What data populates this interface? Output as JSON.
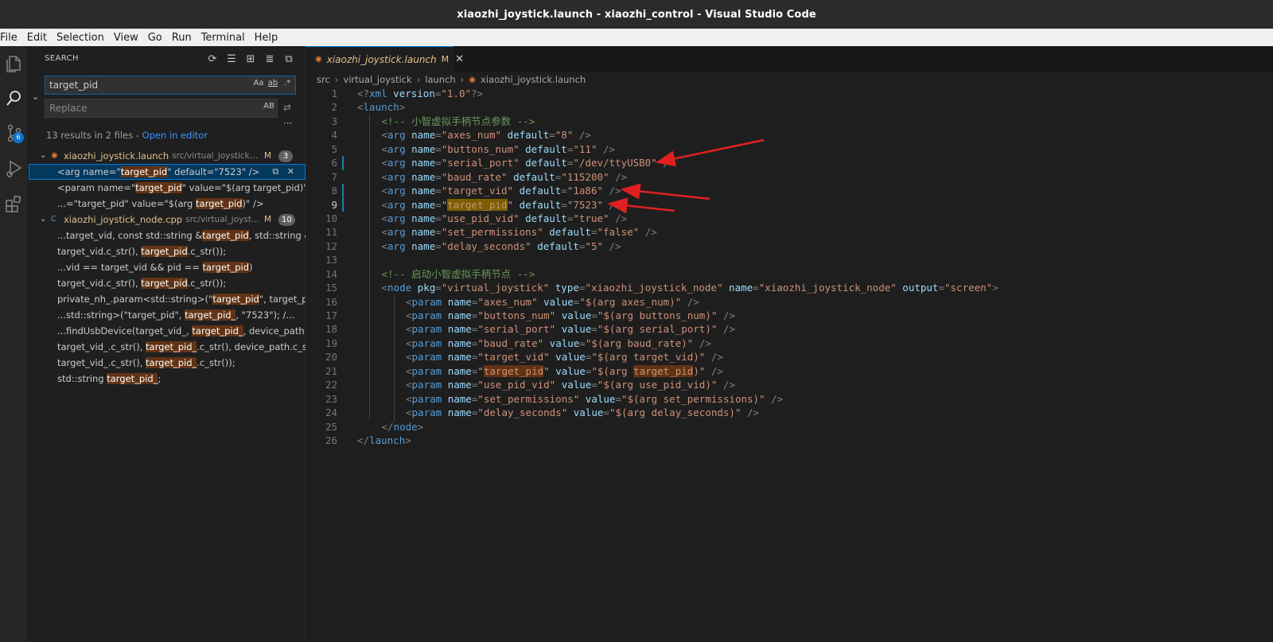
{
  "window": {
    "title": "xiaozhi_joystick.launch - xiaozhi_control - Visual Studio Code"
  },
  "menu": [
    "File",
    "Edit",
    "Selection",
    "View",
    "Go",
    "Run",
    "Terminal",
    "Help"
  ],
  "activity": {
    "scm_badge": "6"
  },
  "search": {
    "header": "SEARCH",
    "query": "target_pid",
    "replace_placeholder": "Replace",
    "opt_case": "Aa",
    "opt_word": "ab",
    "opt_regex": ".*",
    "opt_preserve_case": "AB",
    "summary_text": "13 results in 2 files - ",
    "open_in_editor": "Open in editor"
  },
  "results": [
    {
      "file": "xiaozhi_joystick.launch",
      "path": "src/virtual_joystick/l...",
      "status": "M",
      "count": "3",
      "matches": [
        {
          "pre": "<arg name=\"",
          "hit": "target_pid",
          "post": "\" default=\"7523\" />",
          "selected": true
        },
        {
          "pre": "<param name=\"",
          "hit": "target_pid",
          "post": "\" value=\"$(arg target_pid)\" />"
        },
        {
          "pre": "...=\"target_pid\" value=\"$(arg ",
          "hit": "target_pid",
          "post": ")\" />"
        }
      ]
    },
    {
      "file": "xiaozhi_joystick_node.cpp",
      "path": "src/virtual_joyst...",
      "status": "M",
      "count": "10",
      "matches": [
        {
          "pre": "...target_vid, const std::string &",
          "hit": "target_pid",
          "post": ", std::string &..."
        },
        {
          "pre": "target_vid.c_str(), ",
          "hit": "target_pid",
          "post": ".c_str());"
        },
        {
          "pre": "...vid == target_vid && pid == ",
          "hit": "target_pid",
          "post": ")"
        },
        {
          "pre": "target_vid.c_str(), ",
          "hit": "target_pid",
          "post": ".c_str());"
        },
        {
          "pre": "private_nh_.param<std::string>(\"",
          "hit": "target_pid",
          "post": "\", target_pi..."
        },
        {
          "pre": "...std::string>(\"target_pid\", ",
          "hit": "target_pid_",
          "post": ", \"7523\");        /..."
        },
        {
          "pre": "...findUsbDevice(target_vid_, ",
          "hit": "target_pid_",
          "post": ", device_path))"
        },
        {
          "pre": "target_vid_.c_str(), ",
          "hit": "target_pid_",
          "post": ".c_str(), device_path.c_s..."
        },
        {
          "pre": "target_vid_.c_str(), ",
          "hit": "target_pid_",
          "post": ".c_str());"
        },
        {
          "pre": "std::string ",
          "hit": "target_pid_",
          "post": ";"
        }
      ]
    }
  ],
  "editor": {
    "tab_label": "xiaozhi_joystick.launch",
    "tab_status": "M",
    "breadcrumb": [
      "src",
      "virtual_joystick",
      "launch",
      "xiaozhi_joystick.launch"
    ],
    "active_line": "9",
    "lines": [
      {
        "n": "1",
        "indent": 0,
        "tokens": [
          [
            "p",
            "<?"
          ],
          [
            "t",
            "xml"
          ],
          [
            "a",
            " version"
          ],
          [
            "p",
            "="
          ],
          [
            "s",
            "\"1.0\""
          ],
          [
            "p",
            "?>"
          ]
        ]
      },
      {
        "n": "2",
        "indent": 0,
        "tokens": [
          [
            "p",
            "<"
          ],
          [
            "t",
            "launch"
          ],
          [
            "p",
            ">"
          ]
        ]
      },
      {
        "n": "3",
        "indent": 1,
        "tokens": [
          [
            "c",
            "<!-- 小智虚拟手柄节点参数 -->"
          ]
        ]
      },
      {
        "n": "4",
        "indent": 1,
        "tokens": [
          [
            "p",
            "<"
          ],
          [
            "t",
            "arg"
          ],
          [
            "a",
            " name"
          ],
          [
            "p",
            "="
          ],
          [
            "s",
            "\"axes_num\""
          ],
          [
            "a",
            " default"
          ],
          [
            "p",
            "="
          ],
          [
            "s",
            "\"8\""
          ],
          [
            "p",
            " />"
          ]
        ]
      },
      {
        "n": "5",
        "indent": 1,
        "tokens": [
          [
            "p",
            "<"
          ],
          [
            "t",
            "arg"
          ],
          [
            "a",
            " name"
          ],
          [
            "p",
            "="
          ],
          [
            "s",
            "\"buttons_num\""
          ],
          [
            "a",
            " default"
          ],
          [
            "p",
            "="
          ],
          [
            "s",
            "\"11\""
          ],
          [
            "p",
            " />"
          ]
        ]
      },
      {
        "n": "6",
        "indent": 1,
        "tokens": [
          [
            "p",
            "<"
          ],
          [
            "t",
            "arg"
          ],
          [
            "a",
            " name"
          ],
          [
            "p",
            "="
          ],
          [
            "s",
            "\"serial_port\""
          ],
          [
            "a",
            " default"
          ],
          [
            "p",
            "="
          ],
          [
            "s",
            "\"/dev/ttyUSB0\""
          ],
          [
            "p",
            " />"
          ]
        ]
      },
      {
        "n": "7",
        "indent": 1,
        "tokens": [
          [
            "p",
            "<"
          ],
          [
            "t",
            "arg"
          ],
          [
            "a",
            " name"
          ],
          [
            "p",
            "="
          ],
          [
            "s",
            "\"baud_rate\""
          ],
          [
            "a",
            " default"
          ],
          [
            "p",
            "="
          ],
          [
            "s",
            "\"115200\""
          ],
          [
            "p",
            " />"
          ]
        ]
      },
      {
        "n": "8",
        "indent": 1,
        "tokens": [
          [
            "p",
            "<"
          ],
          [
            "t",
            "arg"
          ],
          [
            "a",
            " name"
          ],
          [
            "p",
            "="
          ],
          [
            "s",
            "\"target_vid\""
          ],
          [
            "a",
            " default"
          ],
          [
            "p",
            "="
          ],
          [
            "s",
            "\"1a86\""
          ],
          [
            "p",
            " />"
          ]
        ]
      },
      {
        "n": "9",
        "indent": 1,
        "tokens": [
          [
            "p",
            "<"
          ],
          [
            "t",
            "arg"
          ],
          [
            "a",
            " name"
          ],
          [
            "p",
            "="
          ],
          [
            "s",
            "\""
          ],
          [
            "m",
            "target_pid"
          ],
          [
            "s",
            "\""
          ],
          [
            "a",
            " default"
          ],
          [
            "p",
            "="
          ],
          [
            "s",
            "\"7523\""
          ],
          [
            "p",
            " />"
          ]
        ]
      },
      {
        "n": "10",
        "indent": 1,
        "tokens": [
          [
            "p",
            "<"
          ],
          [
            "t",
            "arg"
          ],
          [
            "a",
            " name"
          ],
          [
            "p",
            "="
          ],
          [
            "s",
            "\"use_pid_vid\""
          ],
          [
            "a",
            " default"
          ],
          [
            "p",
            "="
          ],
          [
            "s",
            "\"true\""
          ],
          [
            "p",
            " />"
          ]
        ]
      },
      {
        "n": "11",
        "indent": 1,
        "tokens": [
          [
            "p",
            "<"
          ],
          [
            "t",
            "arg"
          ],
          [
            "a",
            " name"
          ],
          [
            "p",
            "="
          ],
          [
            "s",
            "\"set_permissions\""
          ],
          [
            "a",
            " default"
          ],
          [
            "p",
            "="
          ],
          [
            "s",
            "\"false\""
          ],
          [
            "p",
            " />"
          ]
        ]
      },
      {
        "n": "12",
        "indent": 1,
        "tokens": [
          [
            "p",
            "<"
          ],
          [
            "t",
            "arg"
          ],
          [
            "a",
            " name"
          ],
          [
            "p",
            "="
          ],
          [
            "s",
            "\"delay_seconds\""
          ],
          [
            "a",
            " default"
          ],
          [
            "p",
            "="
          ],
          [
            "s",
            "\"5\""
          ],
          [
            "p",
            " />"
          ]
        ]
      },
      {
        "n": "13",
        "indent": 0,
        "tokens": []
      },
      {
        "n": "14",
        "indent": 1,
        "tokens": [
          [
            "c",
            "<!-- 启动小智虚拟手柄节点 -->"
          ]
        ]
      },
      {
        "n": "15",
        "indent": 1,
        "tokens": [
          [
            "p",
            "<"
          ],
          [
            "t",
            "node"
          ],
          [
            "a",
            " pkg"
          ],
          [
            "p",
            "="
          ],
          [
            "s",
            "\"virtual_joystick\""
          ],
          [
            "a",
            " type"
          ],
          [
            "p",
            "="
          ],
          [
            "s",
            "\"xiaozhi_joystick_node\""
          ],
          [
            "a",
            " name"
          ],
          [
            "p",
            "="
          ],
          [
            "s",
            "\"xiaozhi_joystick_node\""
          ],
          [
            "a",
            " output"
          ],
          [
            "p",
            "="
          ],
          [
            "s",
            "\"screen\""
          ],
          [
            "p",
            ">"
          ]
        ]
      },
      {
        "n": "16",
        "indent": 2,
        "tokens": [
          [
            "p",
            "<"
          ],
          [
            "t",
            "param"
          ],
          [
            "a",
            " name"
          ],
          [
            "p",
            "="
          ],
          [
            "s",
            "\"axes_num\""
          ],
          [
            "a",
            " value"
          ],
          [
            "p",
            "="
          ],
          [
            "s",
            "\"$(arg axes_num)\""
          ],
          [
            "p",
            " />"
          ]
        ]
      },
      {
        "n": "17",
        "indent": 2,
        "tokens": [
          [
            "p",
            "<"
          ],
          [
            "t",
            "param"
          ],
          [
            "a",
            " name"
          ],
          [
            "p",
            "="
          ],
          [
            "s",
            "\"buttons_num\""
          ],
          [
            "a",
            " value"
          ],
          [
            "p",
            "="
          ],
          [
            "s",
            "\"$(arg buttons_num)\""
          ],
          [
            "p",
            " />"
          ]
        ]
      },
      {
        "n": "18",
        "indent": 2,
        "tokens": [
          [
            "p",
            "<"
          ],
          [
            "t",
            "param"
          ],
          [
            "a",
            " name"
          ],
          [
            "p",
            "="
          ],
          [
            "s",
            "\"serial_port\""
          ],
          [
            "a",
            " value"
          ],
          [
            "p",
            "="
          ],
          [
            "s",
            "\"$(arg serial_port)\""
          ],
          [
            "p",
            " />"
          ]
        ]
      },
      {
        "n": "19",
        "indent": 2,
        "tokens": [
          [
            "p",
            "<"
          ],
          [
            "t",
            "param"
          ],
          [
            "a",
            " name"
          ],
          [
            "p",
            "="
          ],
          [
            "s",
            "\"baud_rate\""
          ],
          [
            "a",
            " value"
          ],
          [
            "p",
            "="
          ],
          [
            "s",
            "\"$(arg baud_rate)\""
          ],
          [
            "p",
            " />"
          ]
        ]
      },
      {
        "n": "20",
        "indent": 2,
        "tokens": [
          [
            "p",
            "<"
          ],
          [
            "t",
            "param"
          ],
          [
            "a",
            " name"
          ],
          [
            "p",
            "="
          ],
          [
            "s",
            "\"target_vid\""
          ],
          [
            "a",
            " value"
          ],
          [
            "p",
            "="
          ],
          [
            "s",
            "\"$(arg target_vid)\""
          ],
          [
            "p",
            " />"
          ]
        ]
      },
      {
        "n": "21",
        "indent": 2,
        "tokens": [
          [
            "p",
            "<"
          ],
          [
            "t",
            "param"
          ],
          [
            "a",
            " name"
          ],
          [
            "p",
            "="
          ],
          [
            "s",
            "\""
          ],
          [
            "n",
            "target_pid"
          ],
          [
            "s",
            "\""
          ],
          [
            "a",
            " value"
          ],
          [
            "p",
            "="
          ],
          [
            "s",
            "\"$(arg "
          ],
          [
            "n",
            "target_pid"
          ],
          [
            "s",
            ")\""
          ],
          [
            "p",
            " />"
          ]
        ]
      },
      {
        "n": "22",
        "indent": 2,
        "tokens": [
          [
            "p",
            "<"
          ],
          [
            "t",
            "param"
          ],
          [
            "a",
            " name"
          ],
          [
            "p",
            "="
          ],
          [
            "s",
            "\"use_pid_vid\""
          ],
          [
            "a",
            " value"
          ],
          [
            "p",
            "="
          ],
          [
            "s",
            "\"$(arg use_pid_vid)\""
          ],
          [
            "p",
            " />"
          ]
        ]
      },
      {
        "n": "23",
        "indent": 2,
        "tokens": [
          [
            "p",
            "<"
          ],
          [
            "t",
            "param"
          ],
          [
            "a",
            " name"
          ],
          [
            "p",
            "="
          ],
          [
            "s",
            "\"set_permissions\""
          ],
          [
            "a",
            " value"
          ],
          [
            "p",
            "="
          ],
          [
            "s",
            "\"$(arg set_permissions)\""
          ],
          [
            "p",
            " />"
          ]
        ]
      },
      {
        "n": "24",
        "indent": 2,
        "tokens": [
          [
            "p",
            "<"
          ],
          [
            "t",
            "param"
          ],
          [
            "a",
            " name"
          ],
          [
            "p",
            "="
          ],
          [
            "s",
            "\"delay_seconds\""
          ],
          [
            "a",
            " value"
          ],
          [
            "p",
            "="
          ],
          [
            "s",
            "\"$(arg delay_seconds)\""
          ],
          [
            "p",
            " />"
          ]
        ]
      },
      {
        "n": "25",
        "indent": 1,
        "tokens": [
          [
            "p",
            "</"
          ],
          [
            "t",
            "node"
          ],
          [
            "p",
            ">"
          ]
        ]
      },
      {
        "n": "26",
        "indent": 0,
        "tokens": [
          [
            "p",
            "</"
          ],
          [
            "t",
            "launch"
          ],
          [
            "p",
            ">"
          ]
        ]
      }
    ]
  },
  "annotations": {
    "arrow_color": "#e02020",
    "targets": [
      "6",
      "8",
      "9"
    ]
  },
  "colors": {
    "accent": "#0078d4",
    "match_highlight": "#623315",
    "active_match": "#7a5f00",
    "modified": "#e2c08d"
  }
}
